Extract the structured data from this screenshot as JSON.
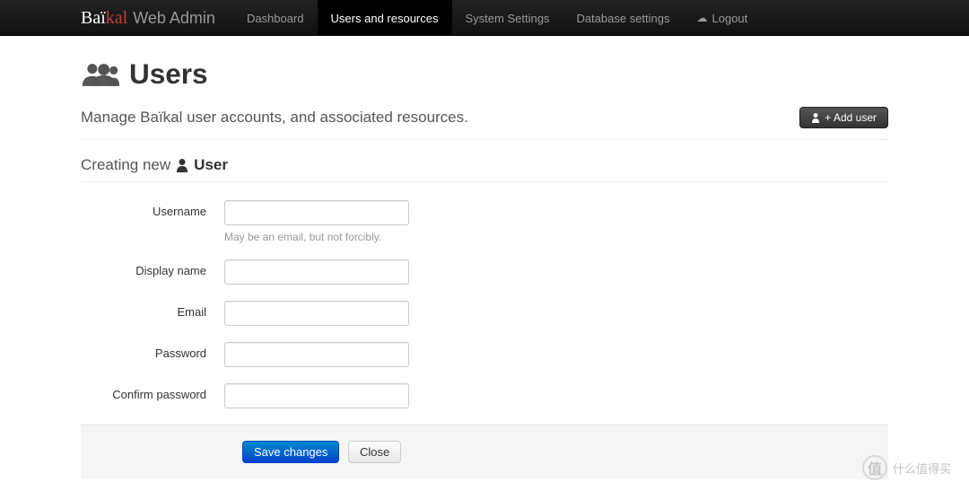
{
  "brand": {
    "bai": "Baï",
    "kal": "kal",
    "suffix": "Web Admin"
  },
  "nav": {
    "dashboard": "Dashboard",
    "users": "Users and resources",
    "system": "System Settings",
    "database": "Database settings",
    "logout": "Logout"
  },
  "page": {
    "title": "Users",
    "subtitle": "Manage Baïkal user accounts, and associated resources.",
    "add_user": "+ Add user"
  },
  "section": {
    "creating": "Creating new",
    "entity": "User"
  },
  "form": {
    "username": {
      "label": "Username",
      "help": "May be an email, but not forcibly.",
      "value": ""
    },
    "displayname": {
      "label": "Display name",
      "value": ""
    },
    "email": {
      "label": "Email",
      "value": ""
    },
    "password": {
      "label": "Password",
      "value": ""
    },
    "confirm": {
      "label": "Confirm password",
      "value": ""
    }
  },
  "actions": {
    "save": "Save changes",
    "close": "Close"
  },
  "watermark": "什么值得买"
}
